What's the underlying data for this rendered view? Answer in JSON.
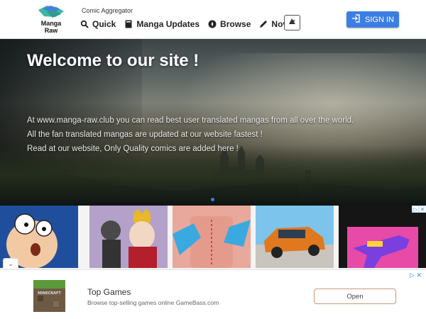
{
  "header": {
    "logo_text_line1": "Manga",
    "logo_text_line2": "Raw",
    "tagline": "Comic Aggregator",
    "nav": [
      {
        "label": "Quick",
        "icon": "search-icon"
      },
      {
        "label": "Manga Updates",
        "icon": "book-icon"
      },
      {
        "label": "Browse",
        "icon": "compass-icon"
      },
      {
        "label": "Novels",
        "icon": "pen-icon"
      }
    ],
    "theme_icon": "dark-mode-icon",
    "signin_label": "SIGN IN",
    "accent_color": "#3d7ee4"
  },
  "hero": {
    "title": "Welcome to our site !",
    "lines": [
      "At www.manga-raw.club you can read best user translated mangas from all over the world.",
      "All the fan translated mangas are updated at our website fastest !",
      "Read at our website, Only Quality comics are added here !"
    ]
  },
  "ads": {
    "cards": [
      {
        "name": "cartoon-boy-ad"
      },
      {
        "name": "king-cartoon-ad"
      },
      {
        "name": "surgery-game-ad"
      },
      {
        "name": "car-game-ad"
      },
      {
        "name": "toy-gun-ad"
      }
    ],
    "collapse_glyph": "⌄"
  },
  "bottom_ad": {
    "title": "Top Games",
    "subtitle": "Browse top-selling games online GameBass.com",
    "button": "Open",
    "icon_text": "MINECRAFT"
  }
}
